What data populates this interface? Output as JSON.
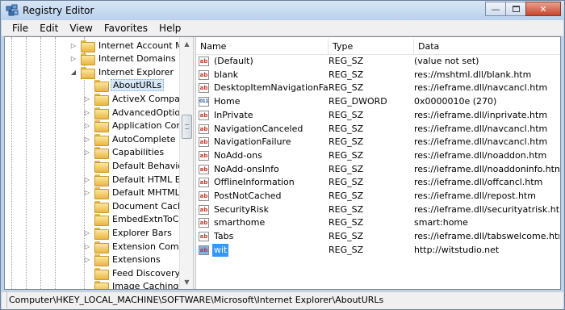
{
  "window": {
    "title": "Registry Editor",
    "colors": {
      "titlebar": "#bcd4ee",
      "selection": "#3399ff",
      "close_button": "#c7462c"
    }
  },
  "menubar": {
    "items": [
      {
        "label": "File",
        "accel": "F",
        "rest": "ile"
      },
      {
        "label": "Edit",
        "accel": "E",
        "rest": "dit"
      },
      {
        "label": "View",
        "accel": "V",
        "rest": "iew"
      },
      {
        "label": "Favorites",
        "accel": "",
        "rest": "Favorites"
      },
      {
        "label": "Help",
        "accel": "H",
        "rest": "elp"
      }
    ]
  },
  "tree": {
    "items": [
      {
        "label": "Internet Account Man",
        "expander": "▷",
        "selected": false
      },
      {
        "label": "Internet Domains",
        "expander": "▷",
        "selected": false
      },
      {
        "label": "Internet Explorer",
        "expander": "◢",
        "selected": false
      },
      {
        "label": "AboutURLs",
        "expander": "",
        "selected": true
      },
      {
        "label": "ActiveX Compatib",
        "expander": "▷",
        "selected": false
      },
      {
        "label": "AdvancedOptions",
        "expander": "▷",
        "selected": false
      },
      {
        "label": "Application Comp",
        "expander": "▷",
        "selected": false
      },
      {
        "label": "AutoComplete",
        "expander": "▷",
        "selected": false
      },
      {
        "label": "Capabilities",
        "expander": "▷",
        "selected": false
      },
      {
        "label": "Default Behaviors",
        "expander": "",
        "selected": false
      },
      {
        "label": "Default HTML Edit",
        "expander": "▷",
        "selected": false
      },
      {
        "label": "Default MHTML Ed",
        "expander": "▷",
        "selected": false
      },
      {
        "label": "Document Cachin",
        "expander": "",
        "selected": false
      },
      {
        "label": "EmbedExtnToClsic",
        "expander": "",
        "selected": false
      },
      {
        "label": "Explorer Bars",
        "expander": "▷",
        "selected": false
      },
      {
        "label": "Extension Compat",
        "expander": "▷",
        "selected": false
      },
      {
        "label": "Extensions",
        "expander": "▷",
        "selected": false
      },
      {
        "label": "Feed Discovery",
        "expander": "",
        "selected": false
      },
      {
        "label": "Image Caching",
        "expander": "",
        "selected": false
      }
    ]
  },
  "list": {
    "columns": {
      "name": "Name",
      "type": "Type",
      "data": "Data"
    },
    "rows": [
      {
        "name": "(Default)",
        "type": "REG_SZ",
        "data": "(value not set)",
        "icon": "string-value-icon",
        "kind": "sz",
        "selected": false
      },
      {
        "name": "blank",
        "type": "REG_SZ",
        "data": "res://mshtml.dll/blank.htm",
        "icon": "string-value-icon",
        "kind": "sz",
        "selected": false
      },
      {
        "name": "DesktopItemNavigationFailu...",
        "type": "REG_SZ",
        "data": "res://ieframe.dll/navcancl.htm",
        "icon": "string-value-icon",
        "kind": "sz",
        "selected": false
      },
      {
        "name": "Home",
        "type": "REG_DWORD",
        "data": "0x0000010e (270)",
        "icon": "dword-value-icon",
        "kind": "dword",
        "selected": false
      },
      {
        "name": "InPrivate",
        "type": "REG_SZ",
        "data": "res://ieframe.dll/inprivate.htm",
        "icon": "string-value-icon",
        "kind": "sz",
        "selected": false
      },
      {
        "name": "NavigationCanceled",
        "type": "REG_SZ",
        "data": "res://ieframe.dll/navcancl.htm",
        "icon": "string-value-icon",
        "kind": "sz",
        "selected": false
      },
      {
        "name": "NavigationFailure",
        "type": "REG_SZ",
        "data": "res://ieframe.dll/navcancl.htm",
        "icon": "string-value-icon",
        "kind": "sz",
        "selected": false
      },
      {
        "name": "NoAdd-ons",
        "type": "REG_SZ",
        "data": "res://ieframe.dll/noaddon.htm",
        "icon": "string-value-icon",
        "kind": "sz",
        "selected": false
      },
      {
        "name": "NoAdd-onsInfo",
        "type": "REG_SZ",
        "data": "res://ieframe.dll/noaddoninfo.htm",
        "icon": "string-value-icon",
        "kind": "sz",
        "selected": false
      },
      {
        "name": "OfflineInformation",
        "type": "REG_SZ",
        "data": "res://ieframe.dll/offcancl.htm",
        "icon": "string-value-icon",
        "kind": "sz",
        "selected": false
      },
      {
        "name": "PostNotCached",
        "type": "REG_SZ",
        "data": "res://ieframe.dll/repost.htm",
        "icon": "string-value-icon",
        "kind": "sz",
        "selected": false
      },
      {
        "name": "SecurityRisk",
        "type": "REG_SZ",
        "data": "res://ieframe.dll/securityatrisk.htm",
        "icon": "string-value-icon",
        "kind": "sz",
        "selected": false
      },
      {
        "name": "smarthome",
        "type": "REG_SZ",
        "data": "smart:home",
        "icon": "string-value-icon",
        "kind": "sz",
        "selected": false
      },
      {
        "name": "Tabs",
        "type": "REG_SZ",
        "data": "res://ieframe.dll/tabswelcome.htm",
        "icon": "string-value-icon",
        "kind": "sz",
        "selected": false
      },
      {
        "name": "wit",
        "type": "REG_SZ",
        "data": "http://witstudio.net",
        "icon": "string-value-icon",
        "kind": "sz",
        "selected": true
      }
    ]
  },
  "statusbar": {
    "path": "Computer\\HKEY_LOCAL_MACHINE\\SOFTWARE\\Microsoft\\Internet Explorer\\AboutURLs"
  }
}
